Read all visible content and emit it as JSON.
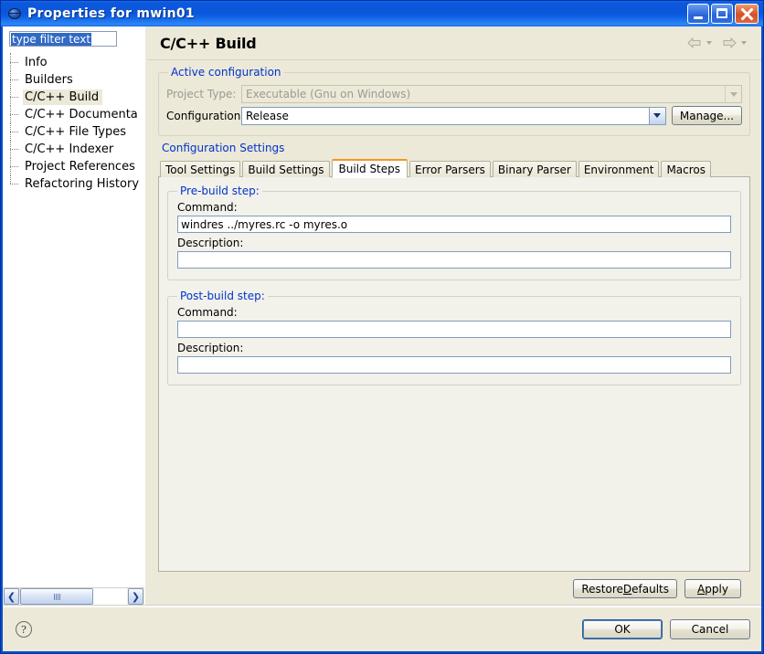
{
  "window": {
    "title": "Properties for mwin01",
    "icon": "globe-icon",
    "minimize_label": "Minimize",
    "maximize_label": "Maximize",
    "close_label": "Close"
  },
  "sidebar": {
    "filter": {
      "value": "type filter text",
      "placeholder": "type filter text",
      "selected": true
    },
    "items": [
      {
        "label": "Info",
        "selected": false
      },
      {
        "label": "Builders",
        "selected": false
      },
      {
        "label": "C/C++ Build",
        "selected": true
      },
      {
        "label": "C/C++ Documenta",
        "selected": false
      },
      {
        "label": "C/C++ File Types",
        "selected": false
      },
      {
        "label": "C/C++ Indexer",
        "selected": false
      },
      {
        "label": "Project References",
        "selected": false
      },
      {
        "label": "Refactoring History",
        "selected": false
      }
    ],
    "scrollbar": {
      "left_arrow": "❮",
      "right_arrow": "❯"
    }
  },
  "page": {
    "title": "C/C++ Build",
    "nav_back": "back-arrow",
    "nav_forward": "forward-arrow"
  },
  "active_configuration": {
    "legend": "Active configuration",
    "project_type_label": "Project Type:",
    "project_type_value": "Executable (Gnu on Windows)",
    "project_type_disabled": true,
    "configuration_label": "Configuration:",
    "configuration_value": "Release",
    "manage_button": "Manage..."
  },
  "configuration_settings": {
    "legend": "Configuration Settings",
    "tabs": [
      {
        "label": "Tool Settings",
        "active": false
      },
      {
        "label": "Build Settings",
        "active": false
      },
      {
        "label": "Build Steps",
        "active": true
      },
      {
        "label": "Error Parsers",
        "active": false
      },
      {
        "label": "Binary Parser",
        "active": false
      },
      {
        "label": "Environment",
        "active": false
      },
      {
        "label": "Macros",
        "active": false
      }
    ],
    "pre_build": {
      "legend": "Pre-build step:",
      "command_label": "Command:",
      "command_value": "windres ../myres.rc -o myres.o",
      "description_label": "Description:",
      "description_value": ""
    },
    "post_build": {
      "legend": "Post-build step:",
      "command_label": "Command:",
      "command_value": "",
      "description_label": "Description:",
      "description_value": ""
    }
  },
  "actions": {
    "restore_defaults": "Restore ",
    "restore_defaults_mnemonic": "D",
    "restore_defaults_rest": "efaults",
    "apply_mnemonic": "A",
    "apply_rest": "pply",
    "ok": "OK",
    "cancel": "Cancel",
    "help": "?"
  },
  "colors": {
    "accent_tab": "#f7941e",
    "legend_blue": "#0033cc",
    "titlebar_blue": "#0c59dd",
    "dialog_bg": "#ece9d8",
    "selection_blue": "#316ac5"
  }
}
